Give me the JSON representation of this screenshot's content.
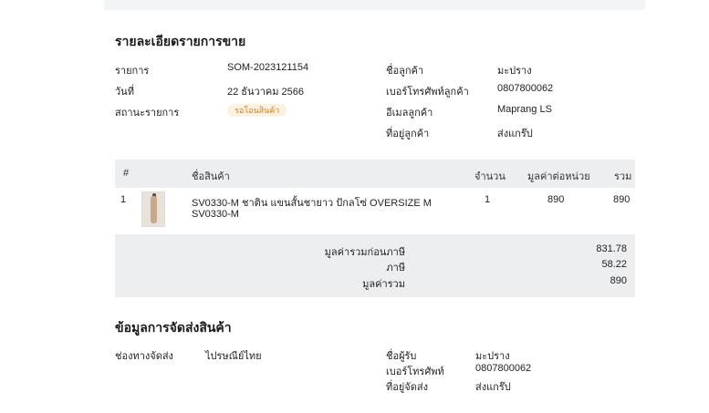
{
  "sale_details": {
    "heading": "รายละเอียดรายการขาย",
    "order_label": "รายการ",
    "order_value": "SOM-2023121154",
    "date_label": "วันที่",
    "date_value": "22 ธันวาคม 2566",
    "status_label": "สถานะรายการ",
    "status_badge": "รอโอนสินค้า",
    "customer_name_label": "ชื่อลูกค้า",
    "customer_name_value": "มะปราง",
    "customer_phone_label": "เบอร์โทรศัพท์ลูกค้า",
    "customer_phone_value": "0807800062",
    "customer_email_label": "อีเมลลูกค้า",
    "customer_email_value": "Maprang LS",
    "customer_address_label": "ที่อยู่ลูกค้า",
    "customer_address_value": "ส่งแกร๊ป"
  },
  "items_table": {
    "columns": {
      "index": "#",
      "product": "ชื่อสินค้า",
      "qty": "จำนวน",
      "unit_price": "มูลค่าต่อหน่วย",
      "total": "รวม"
    },
    "rows": [
      {
        "index": "1",
        "name_line1": "SV0330-M ชาติน แขนสั้นชายาว ปักลโซ่ OVERSIZE M",
        "name_line2": "SV0330-M",
        "qty": "1",
        "unit_price": "890",
        "total": "890"
      }
    ]
  },
  "summary": {
    "subtotal_label": "มูลค่ารวมก่อนภาษี",
    "subtotal_value": "831.78",
    "tax_label": "ภาษี",
    "tax_value": "58.22",
    "grand_total_label": "มูลค่ารวม",
    "grand_total_value": "890"
  },
  "shipping": {
    "heading": "ข้อมูลการจัดส่งสินค้า",
    "channel_label": "ช่องทางจัดส่ง",
    "channel_value": "ไปรษณีย์ไทย",
    "recipient_label": "ชื่อผู้รับ",
    "recipient_value": "มะปราง",
    "phone_label": "เบอร์โทรศัพท์",
    "phone_value": "0807800062",
    "address_label": "ที่อยู่จัดส่ง",
    "address_value": "ส่งแกร๊ป"
  },
  "colors": {
    "badge_bg": "#fdf1e0",
    "badge_text": "#d27f1a",
    "table_header_bg": "#eceef0"
  }
}
